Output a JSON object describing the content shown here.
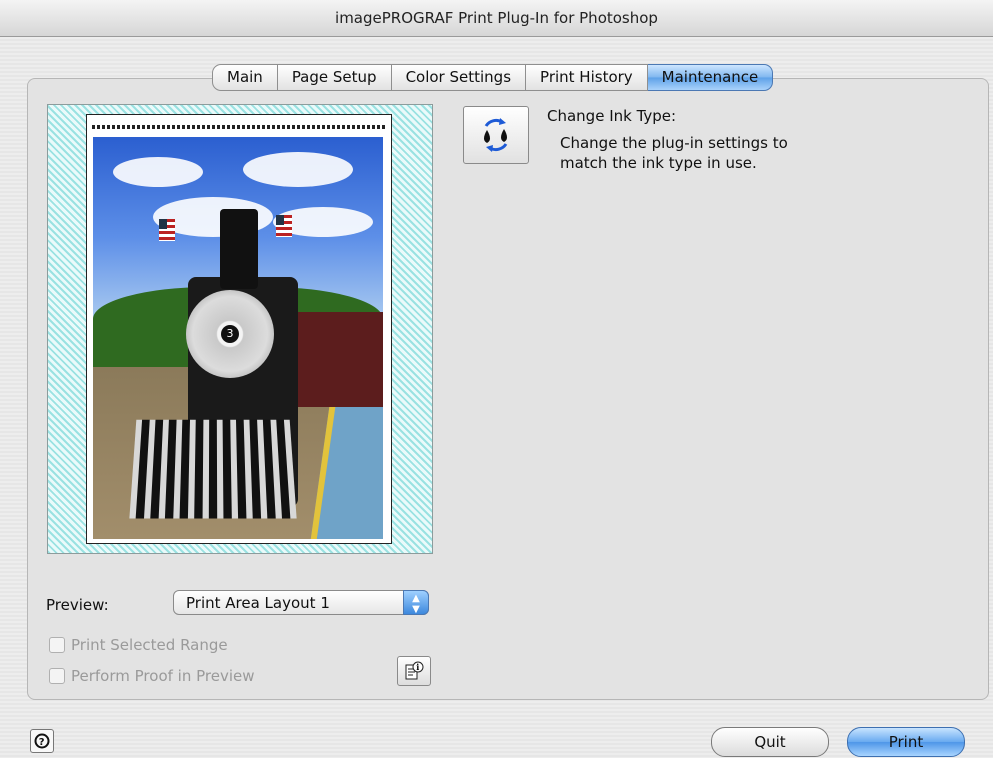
{
  "window": {
    "title": "imagePROGRAF Print Plug-In for Photoshop"
  },
  "tabs": [
    {
      "label": "Main"
    },
    {
      "label": "Page Setup"
    },
    {
      "label": "Color Settings"
    },
    {
      "label": "Print History"
    },
    {
      "label": "Maintenance",
      "active": true
    }
  ],
  "preview": {
    "label": "Preview:",
    "layout_value": "Print Area Layout 1",
    "page_header_text": "",
    "image_subject": "steam locomotive number 3 with flags",
    "locomotive_number": "3"
  },
  "options": {
    "print_selected_range": "Print Selected Range",
    "perform_proof_in_preview": "Perform Proof in Preview"
  },
  "maintenance": {
    "change_ink_title": "Change Ink Type:",
    "change_ink_desc": "Change the plug-in settings to\nmatch the ink type in use."
  },
  "footer": {
    "quit_label": "Quit",
    "print_label": "Print"
  },
  "colors": {
    "accent_blue": "#5ea1e8",
    "hatch_cyan": "#9ae2e2",
    "panel_bg": "#e3e3e3"
  },
  "icons": {
    "help": "question-circle-icon",
    "info": "document-info-icon",
    "ink": "ink-drops-refresh-icon",
    "popup": "updown-arrows-icon"
  }
}
